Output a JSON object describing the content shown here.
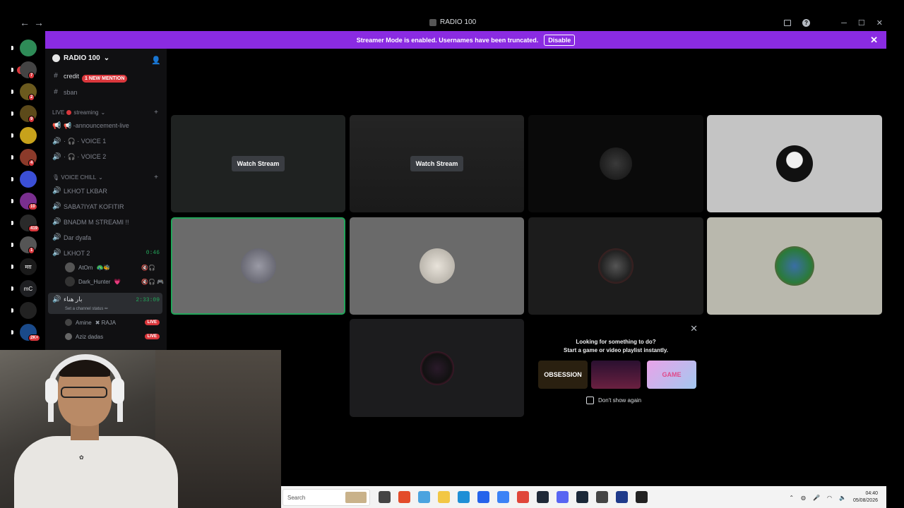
{
  "window": {
    "title": "RADIO 100",
    "nav_back": "←",
    "nav_forward": "→",
    "minimize": "─",
    "maximize": "☐",
    "close": "✕",
    "help": "?"
  },
  "banner": {
    "message": "Streamer Mode is enabled. Usernames have been truncated.",
    "button": "Disable",
    "close": "✕"
  },
  "rail": {
    "new_label": "NEW",
    "servers": [
      {
        "color": "#2e8b57",
        "badge": ""
      },
      {
        "color": "#444444",
        "badge": "7"
      },
      {
        "color": "#6b5a1e",
        "badge": "2"
      },
      {
        "color": "#5c4a1a",
        "badge": "9"
      },
      {
        "color": "#c7a21b",
        "badge": ""
      },
      {
        "color": "#8b3a2a",
        "badge": "4"
      },
      {
        "color": "#3b4fd6",
        "badge": ""
      },
      {
        "color": "#7a2f8f",
        "badge": "10"
      },
      {
        "color": "#2a2a2a",
        "badge": "419"
      },
      {
        "color": "#555555",
        "badge": "1"
      },
      {
        "color": "#1a1a1a",
        "badge": "",
        "text": "मग़"
      },
      {
        "color": "#1e1f22",
        "badge": "",
        "text": "mC"
      },
      {
        "color": "#222222",
        "badge": ""
      },
      {
        "color": "#1a4a8a",
        "badge": "2K+"
      }
    ]
  },
  "sidebar": {
    "server_name": "RADIO 100",
    "server_chevron": "⌄",
    "channels_top": [
      {
        "name": "credit",
        "icon": "#"
      },
      {
        "name": "sban",
        "icon": "#"
      }
    ],
    "mention_pill": "1 NEW MENTION",
    "category_live": {
      "prefix": "LIVE",
      "name": "streaming"
    },
    "live_channels": [
      {
        "name": "📢 -announcement-live",
        "icon": "📢"
      },
      {
        "name": "· 🎧 · VOICE 1",
        "icon": "🔊"
      },
      {
        "name": "· 🎧 · VOICE 2",
        "icon": "🔊"
      }
    ],
    "category_chill": "🎙 VOICE CHILL",
    "voice_channels": [
      {
        "name": "LKHOT LKBAR"
      },
      {
        "name": "SABA7IYAT KOFITIR"
      },
      {
        "name": "BNADM M STREAMI !!"
      },
      {
        "name": "Dar dyafa"
      },
      {
        "name": "LKHOT 2",
        "timer": "0:46"
      }
    ],
    "lkhot_users": [
      {
        "name": "AtOm",
        "tag": "🦚🐝",
        "icons": "🔇🎧"
      },
      {
        "name": "Dark_Hunter",
        "tag": "💗",
        "icons": "🔇🎧 🎮"
      }
    ],
    "active_channel": {
      "name": "بار هناء",
      "timer": "2:33:09",
      "status": "Set a channel status ✏"
    },
    "active_users": [
      {
        "name": "Amine",
        "tag": "✖ RAJA",
        "live": "LIVE"
      },
      {
        "name": "Aziz dadas",
        "tag": "",
        "live": "LIVE"
      }
    ]
  },
  "grid": {
    "tiles": [
      {
        "kind": "stream",
        "button": "Watch Stream"
      },
      {
        "kind": "stream",
        "button": "Watch Stream"
      },
      {
        "kind": "avatar"
      },
      {
        "kind": "avatar"
      },
      {
        "kind": "avatar"
      },
      {
        "kind": "avatar"
      },
      {
        "kind": "avatar"
      },
      {
        "kind": "avatar"
      },
      {
        "kind": "avatar"
      }
    ]
  },
  "activity": {
    "line1": "Looking for something to do?",
    "line2": "Start a game or video playlist instantly.",
    "games": [
      "OBSESSION",
      "",
      "GAME"
    ],
    "dont_show": "Don't show again",
    "close": "✕"
  },
  "taskbar": {
    "search_placeholder": "Search",
    "time": "04:40",
    "date": "05/08/2026",
    "app_colors": [
      "#444444",
      "#e34b2a",
      "#4aa3df",
      "#f2c744",
      "#1f8fd6",
      "#2563eb",
      "#3b82f6",
      "#e0463a",
      "#1f2937",
      "#5865f2",
      "#1b2838",
      "#444444",
      "#1f3a8a",
      "#222222"
    ]
  },
  "colors": {
    "accent": "#8a2be2",
    "danger": "#da373c",
    "online": "#23a55a"
  }
}
